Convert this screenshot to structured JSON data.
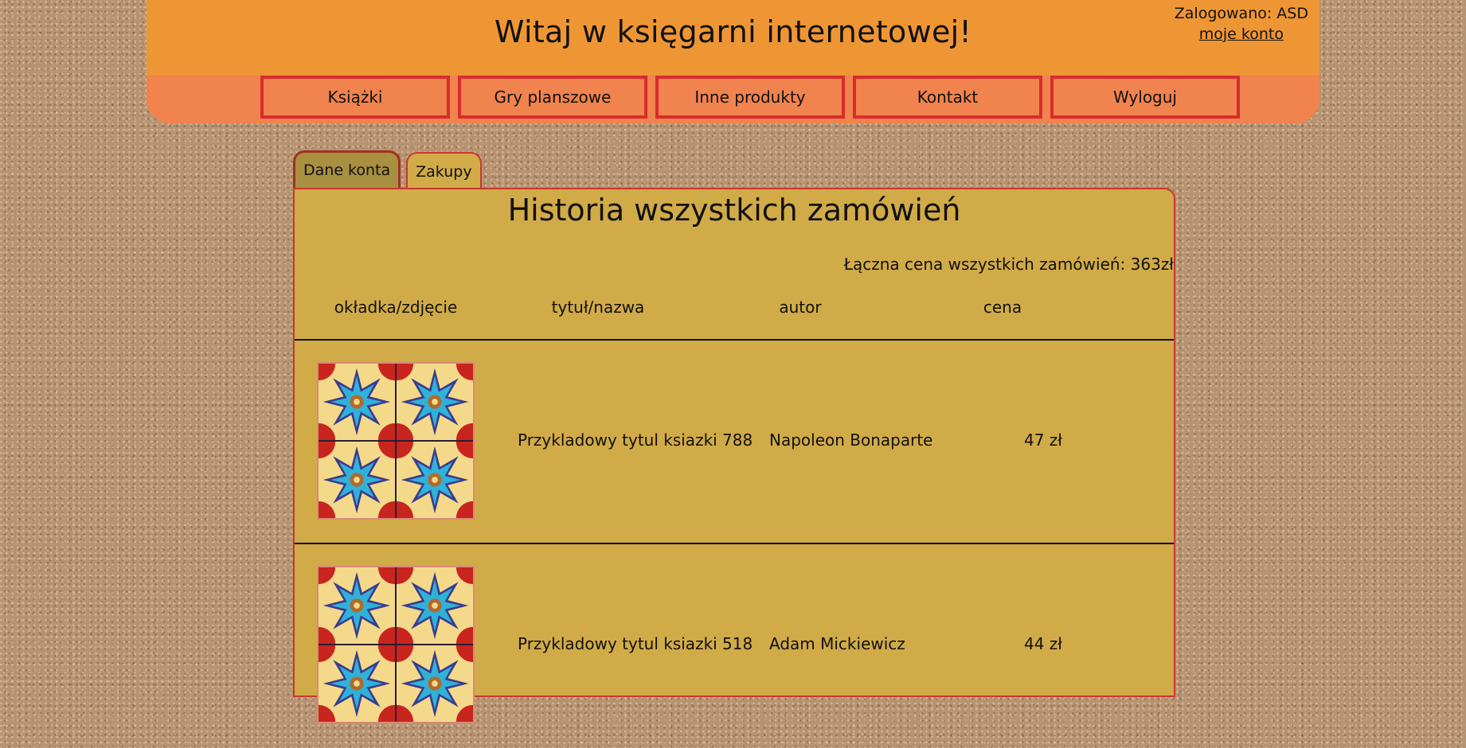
{
  "header": {
    "title": "Witaj w księgarni internetowej!",
    "login_status": "Zalogowano: ASD",
    "account_link": "moje konto"
  },
  "nav": {
    "items": [
      {
        "label": "Książki"
      },
      {
        "label": "Gry planszowe"
      },
      {
        "label": "Inne produkty"
      },
      {
        "label": "Kontakt"
      },
      {
        "label": "Wyloguj"
      }
    ]
  },
  "tabs": {
    "account_data": "Dane konta",
    "purchases": "Zakupy"
  },
  "orders": {
    "title": "Historia wszystkich zamówień",
    "total": "Łączna cena wszystkich zamówień: 363zł",
    "columns": {
      "cover": "okładka/zdjęcie",
      "title": "tytuł/nazwa",
      "author": "autor",
      "price": "cena"
    },
    "rows": [
      {
        "title": "Przykladowy tytul ksiazki 788",
        "author": "Napoleon Bonaparte",
        "price": "47 zł"
      },
      {
        "title": "Przykladowy tytul ksiazki 518",
        "author": "Adam Mickiewicz",
        "price": "44 zł"
      }
    ]
  },
  "colors": {
    "header_orange": "#ef9634",
    "nav_salmon": "#f0834e",
    "nav_border_red": "#d92c2c",
    "panel_mustard": "#d1ab47",
    "active_tab": "#a99041"
  },
  "icons": {
    "cover_image": "star-tile-pattern"
  }
}
